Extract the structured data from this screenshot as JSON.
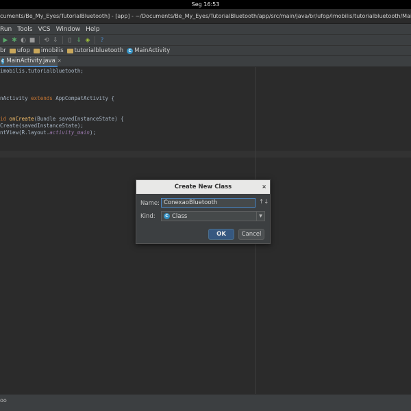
{
  "system": {
    "clock": "Seg 16:53"
  },
  "window": {
    "title": "cuments/Be_My_Eyes/TutorialBluetooth] - [app] - ~/Documents/Be_My_Eyes/TutorialBluetooth/app/src/main/java/br/ufop/imobilis/tutorialbluetooth/MainActivity"
  },
  "menu": {
    "items": [
      "Run",
      "Tools",
      "VCS",
      "Window",
      "Help"
    ]
  },
  "toolbar": {
    "icons": [
      "run-icon",
      "debug-icon",
      "coverage-icon",
      "stop-icon",
      "attach-icon",
      "gradle-sync-icon",
      "avd-manager-icon",
      "sdk-manager-icon",
      "android-icon",
      "help-icon"
    ]
  },
  "breadcrumbs": [
    {
      "label": "br",
      "icon": "folder-icon"
    },
    {
      "label": "ufop",
      "icon": "folder-icon"
    },
    {
      "label": "imobilis",
      "icon": "folder-icon"
    },
    {
      "label": "tutorialbluetooth",
      "icon": "folder-icon"
    },
    {
      "label": "MainActivity",
      "icon": "class-icon"
    }
  ],
  "tabs": [
    {
      "label": "MainActivity.java",
      "icon": "class-icon",
      "active": true
    }
  ],
  "editor": {
    "lines": {
      "l1": "imobilis.tutorialbluetooth;",
      "l2_name": "nActivity ",
      "l2_kw": "extends",
      "l2_rest": " AppCompatActivity {",
      "l3_kw": "id ",
      "l3_fn": "onCreate",
      "l3_rest": "(Bundle savedInstanceState) {",
      "l4": "Create(savedInstanceState);",
      "l5_a": "ntView(R.layout.",
      "l5_it": "activity_main",
      "l5_b": ");"
    }
  },
  "status": {
    "text": "oo"
  },
  "dialog": {
    "title": "Create New Class",
    "close_glyph": "×",
    "name_label": "Name:",
    "name_value": "ConexaoBluetooth",
    "sort_glyph": "↑↓",
    "kind_label": "Kind:",
    "kind_value": "Class",
    "kind_icon_letter": "C",
    "ok_label": "OK",
    "cancel_label": "Cancel"
  },
  "colors": {
    "accent": "#4a88c7",
    "keyword": "#cc7832",
    "method": "#ffc66d",
    "field": "#9876aa",
    "editor_bg": "#2b2b2b",
    "class_icon": "#3592c4"
  }
}
